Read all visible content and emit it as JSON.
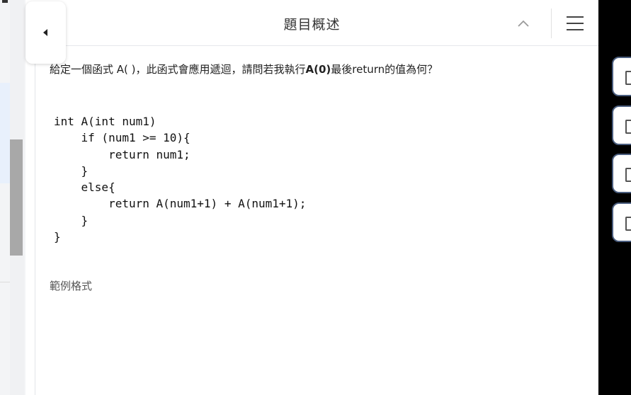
{
  "header": {
    "title": "題目概述"
  },
  "question": {
    "prefix": "給定一個函式 A( )，此函式會應用遞迴，請問若我執行",
    "call": "A(0)",
    "suffix": "最後return的值為何？"
  },
  "code_lines": [
    "int A(int num1)",
    "    if (num1 >= 10){",
    "        return num1;",
    "    }",
    "    else{",
    "        return A(num1+1) + A(num1+1);",
    "    }",
    "}"
  ],
  "example": {
    "label": "範例格式"
  },
  "icons": {
    "collapse": "caret-left-icon",
    "chevron": "chevron-up-icon",
    "menu": "hamburger-menu-icon"
  },
  "colors": {
    "side_tab_border": "#4a5d7e",
    "scroll_thumb": "#a8a8a8"
  }
}
